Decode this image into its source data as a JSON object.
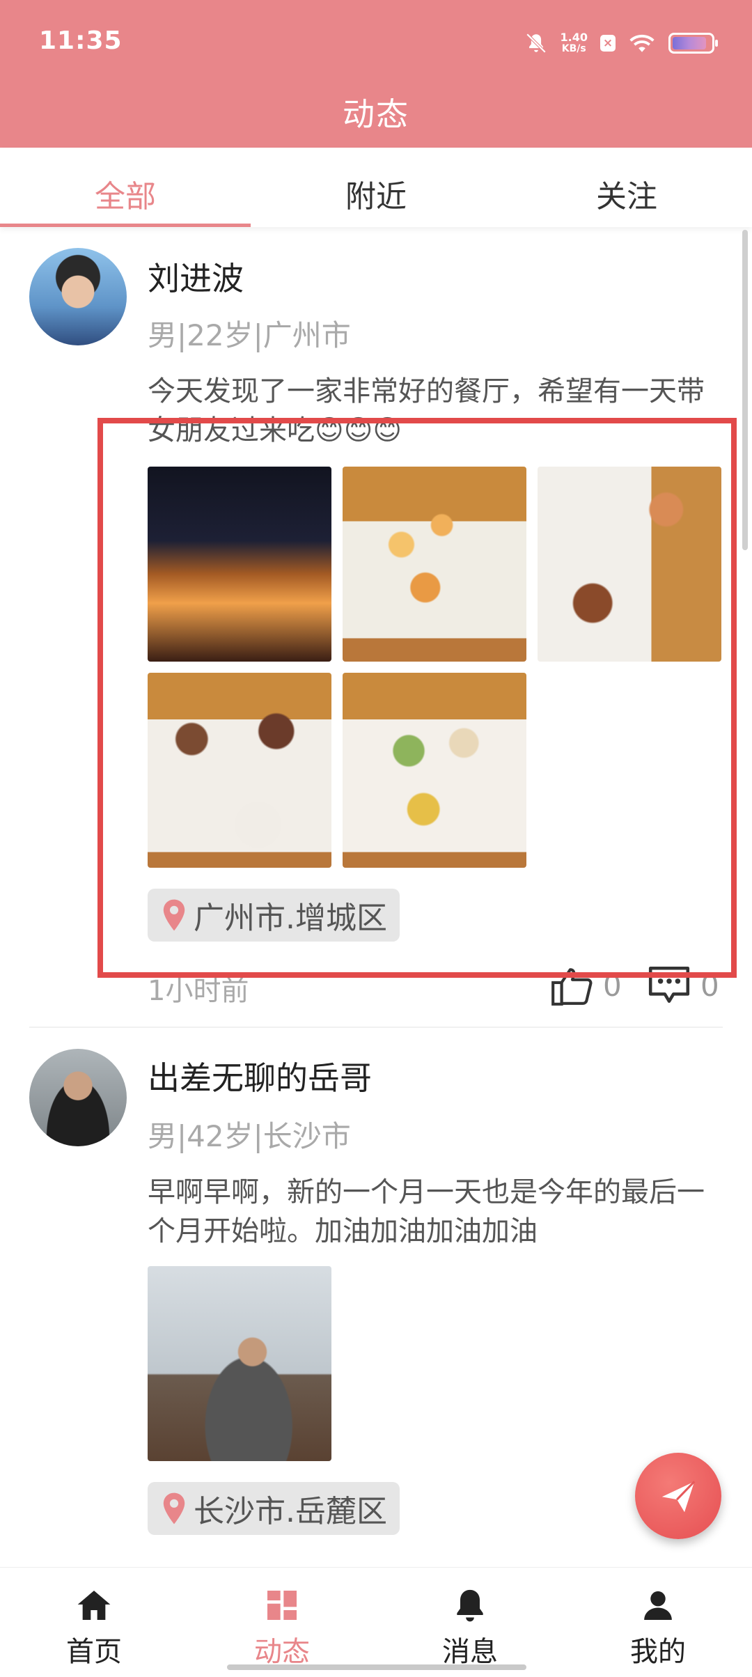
{
  "status_bar": {
    "time": "11:35",
    "speed_value": "1.40",
    "speed_unit": "KB/s"
  },
  "header": {
    "title": "动态"
  },
  "tabs": [
    {
      "label": "全部",
      "active": true
    },
    {
      "label": "附近",
      "active": false
    },
    {
      "label": "关注",
      "active": false
    }
  ],
  "posts": [
    {
      "name": "刘进波",
      "meta": "男|22岁|广州市",
      "content": "今天发现了一家非常好的餐厅，希望有一天带女朋友过来吃😊😊😊",
      "location": "广州市.增城区",
      "time_ago": "1小时前",
      "likes": "0",
      "comments": "0"
    },
    {
      "name": "出差无聊的岳哥",
      "meta": "男|42岁|长沙市",
      "content": "早啊早啊，新的一个月一天也是今年的最后一个月开始啦。加油加油加油加油",
      "location": "长沙市.岳麓区"
    }
  ],
  "bottom_nav": [
    {
      "label": "首页",
      "icon": "home-icon",
      "active": false
    },
    {
      "label": "动态",
      "icon": "grid-icon",
      "active": true
    },
    {
      "label": "消息",
      "icon": "bell-icon",
      "active": false
    },
    {
      "label": "我的",
      "icon": "person-icon",
      "active": false
    }
  ],
  "colors": {
    "accent": "#e8868a",
    "highlight": "#e24a4a",
    "fab": "#e64f52"
  }
}
